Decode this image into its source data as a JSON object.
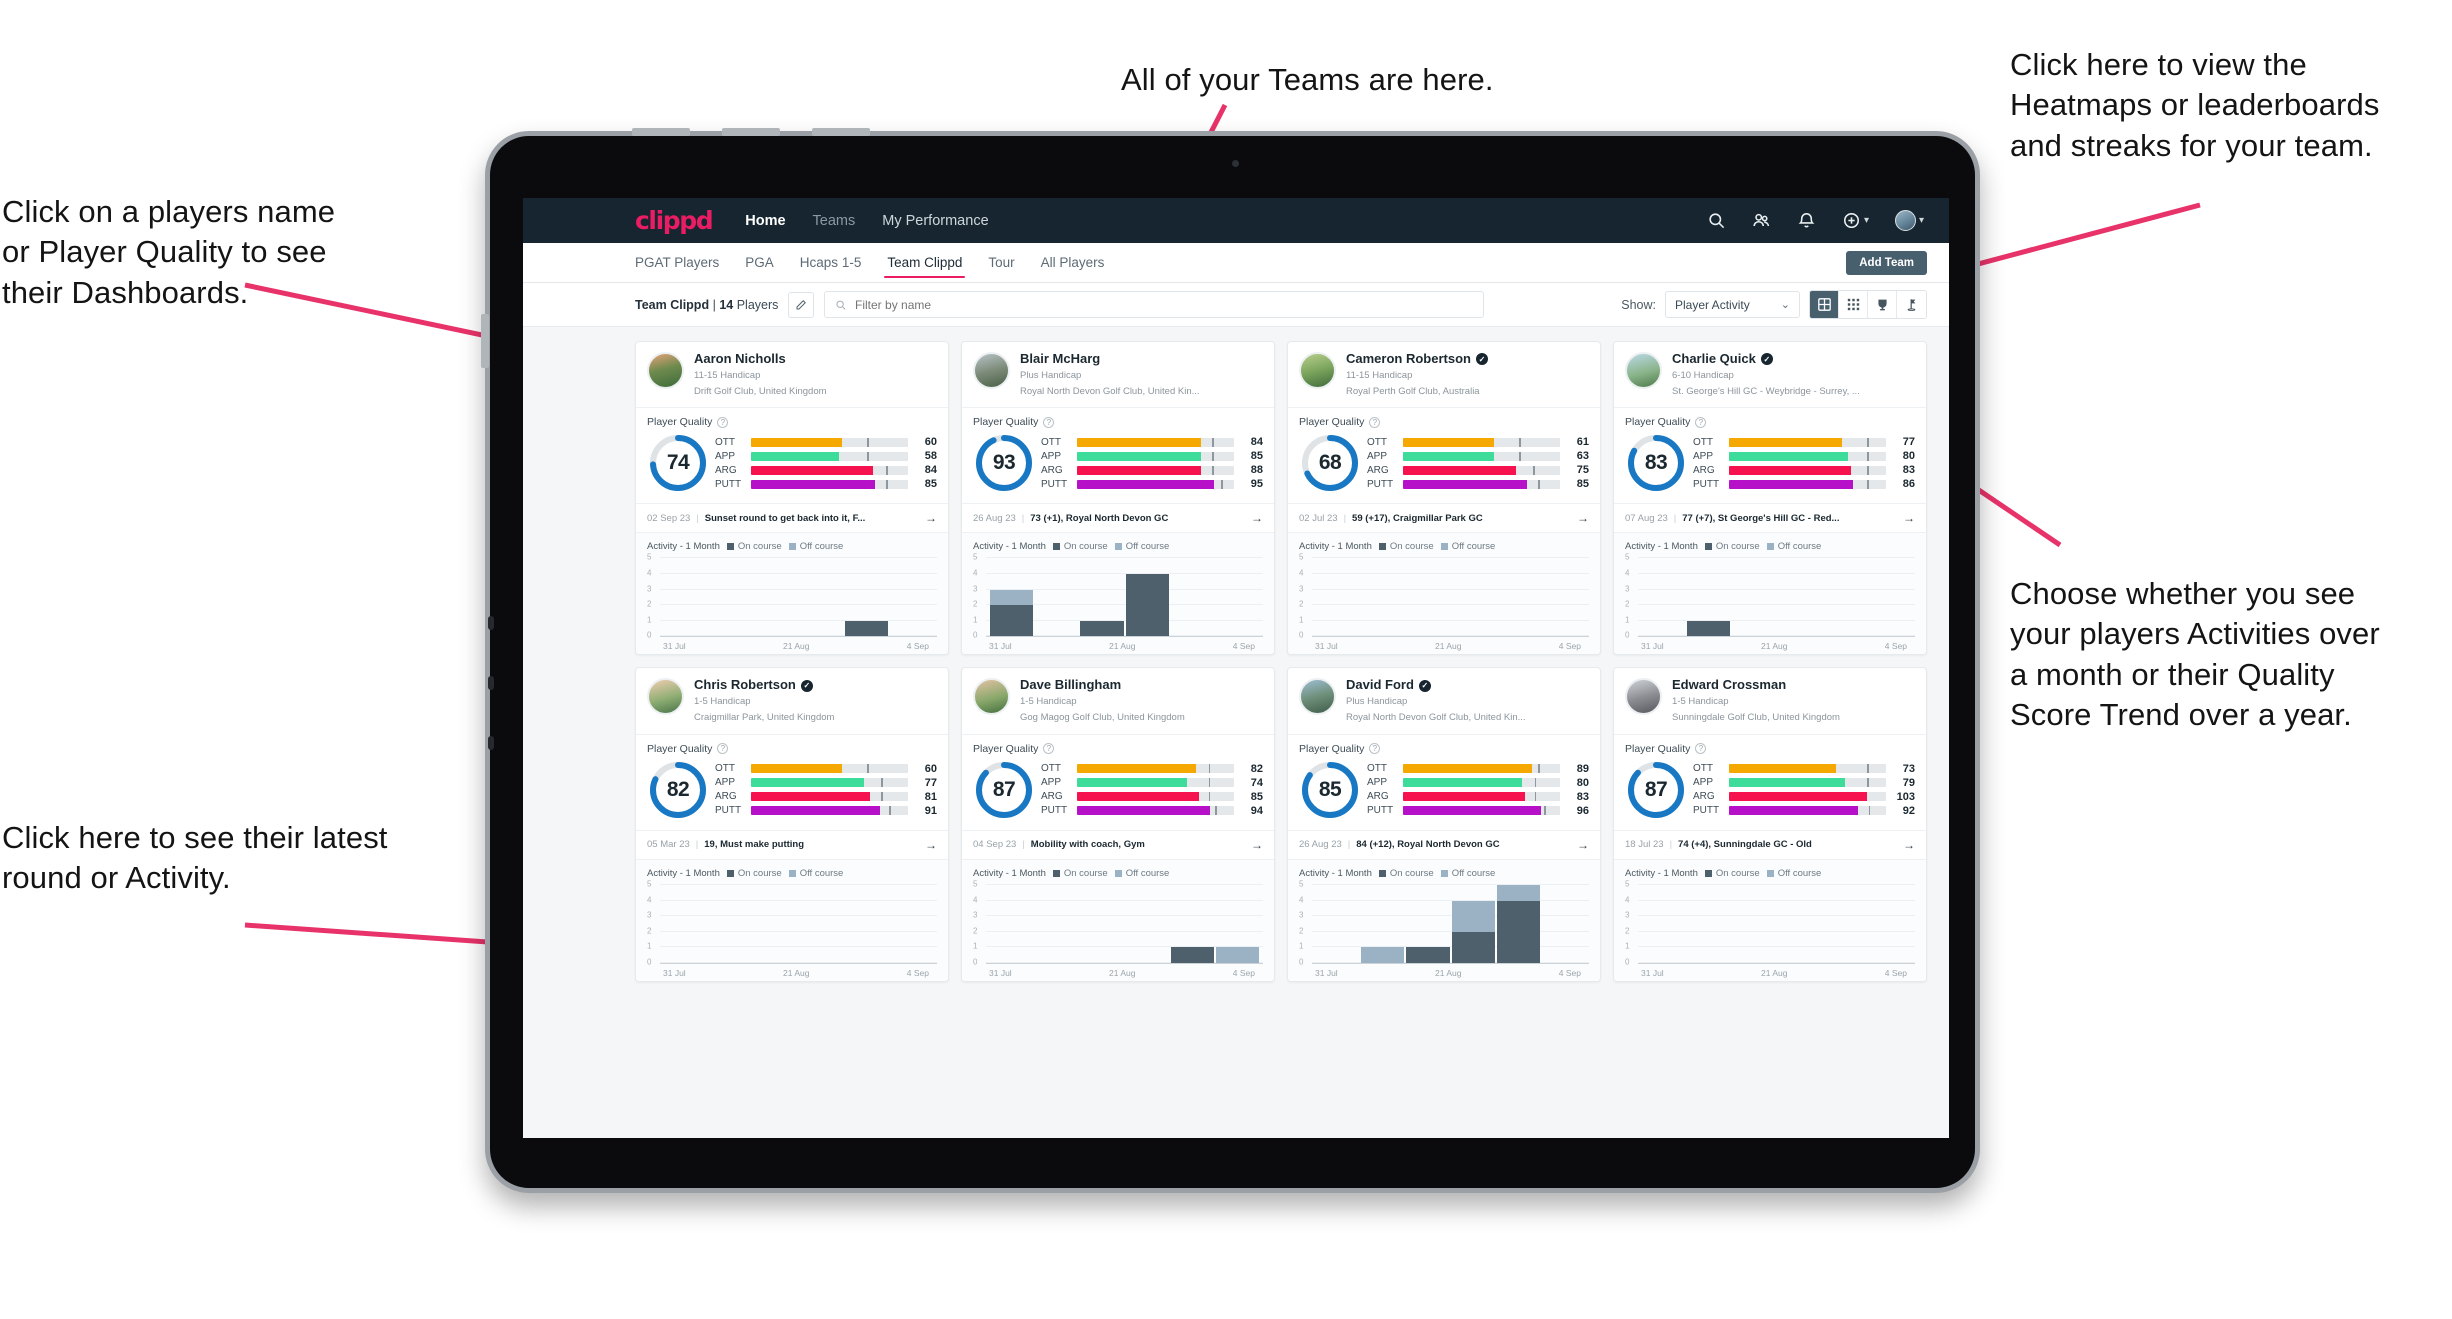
{
  "annotations": {
    "top": "All of your Teams are here.",
    "left_top": "Click on a players name\nor Player Quality to see\ntheir Dashboards.",
    "left_bottom": "Click here to see their latest\nround or Activity.",
    "right_top": "Click here to view the\nHeatmaps or leaderboards\nand streaks for your team.",
    "right_bottom": "Choose whether you see\nyour players Activities over\na month or their Quality\nScore Trend over a year.",
    "arrow_color": "#e8336a"
  },
  "app": {
    "brand": "clippd",
    "nav": [
      {
        "label": "Home",
        "active": true
      },
      {
        "label": "Teams",
        "active": false
      },
      {
        "label": "My Performance",
        "active": false
      }
    ],
    "nav_icons": [
      "search-icon",
      "people-icon",
      "bell-icon",
      "plus-circle-icon",
      "avatar"
    ],
    "tabs": [
      {
        "label": "PGAT Players",
        "active": false
      },
      {
        "label": "PGA",
        "active": false
      },
      {
        "label": "Hcaps 1-5",
        "active": false
      },
      {
        "label": "Team Clippd",
        "active": true
      },
      {
        "label": "Tour",
        "active": false
      },
      {
        "label": "All Players",
        "active": false
      }
    ],
    "add_team_label": "Add Team",
    "toolbar": {
      "team_name": "Team Clippd",
      "separator": "|",
      "player_count": "14",
      "players_word": "Players",
      "edit_icon": "pencil-icon",
      "search_placeholder": "Filter by name",
      "search_value": "",
      "show_label": "Show:",
      "show_value": "Player Activity",
      "view_buttons": [
        "grid-large-icon",
        "grid-small-icon",
        "trophy-icon",
        "flag-icon"
      ],
      "active_view": 0
    },
    "quality_label": "Player Quality",
    "activity_label": "Activity - 1 Month",
    "legend_on": "On course",
    "legend_off": "Off course",
    "x_ticks": [
      "31 Jul",
      "21 Aug",
      "4 Sep"
    ],
    "y_ticks": [
      "5",
      "4",
      "3",
      "2",
      "1",
      "0"
    ],
    "metric_colors": {
      "OTT": "#f5a800",
      "APP": "#3ddc9b",
      "ARG": "#f5124f",
      "PUTT": "#b610c9",
      "ring": "#1878c4",
      "ring_track": "#dfe3e6"
    }
  },
  "chart_data": {
    "type": "bar",
    "title": "Activity - 1 Month",
    "xlabel": "",
    "ylabel": "",
    "ylim": [
      0,
      5
    ],
    "categories": [
      "31 Jul",
      "7 Aug",
      "14 Aug",
      "21 Aug",
      "28 Aug",
      "4 Sep"
    ],
    "legend": [
      "On course",
      "Off course"
    ],
    "legend_position": "top",
    "grid": true,
    "per_player": [
      {
        "player": "Aaron Nicholls",
        "on": [
          0,
          0,
          0,
          0,
          1,
          0
        ],
        "off": [
          0,
          0,
          0,
          0,
          0,
          0
        ]
      },
      {
        "player": "Blair McHarg",
        "on": [
          2,
          0,
          1,
          4,
          0,
          0
        ],
        "off": [
          1,
          0,
          0,
          0,
          0,
          0
        ]
      },
      {
        "player": "Cameron Robertson",
        "on": [
          0,
          0,
          0,
          0,
          0,
          0
        ],
        "off": [
          0,
          0,
          0,
          0,
          0,
          0
        ]
      },
      {
        "player": "Charlie Quick",
        "on": [
          0,
          1,
          0,
          0,
          0,
          0
        ],
        "off": [
          0,
          0,
          0,
          0,
          0,
          0
        ]
      },
      {
        "player": "Chris Robertson",
        "on": [
          0,
          0,
          0,
          0,
          0,
          0
        ],
        "off": [
          0,
          0,
          0,
          0,
          0,
          0
        ]
      },
      {
        "player": "Dave Billingham",
        "on": [
          0,
          0,
          0,
          0,
          1,
          0
        ],
        "off": [
          0,
          0,
          0,
          0,
          0,
          1
        ]
      },
      {
        "player": "David Ford",
        "on": [
          0,
          0,
          1,
          2,
          4,
          0
        ],
        "off": [
          0,
          1,
          0,
          2,
          1,
          0
        ]
      },
      {
        "player": "Edward Crossman",
        "on": [
          0,
          0,
          0,
          0,
          0,
          0
        ],
        "off": [
          0,
          0,
          0,
          0,
          0,
          0
        ]
      }
    ]
  },
  "players": [
    {
      "name": "Aaron Nicholls",
      "verified": false,
      "handicap": "11-15 Handicap",
      "club": "Drift Golf Club, United Kingdom",
      "quality": "74",
      "metrics": [
        {
          "label": "OTT",
          "value": "60",
          "fill": 58,
          "tick": 74
        },
        {
          "label": "APP",
          "value": "58",
          "fill": 56,
          "tick": 74
        },
        {
          "label": "ARG",
          "value": "84",
          "fill": 78,
          "tick": 86
        },
        {
          "label": "PUTT",
          "value": "85",
          "fill": 79,
          "tick": 86
        }
      ],
      "round_date": "02 Sep 23",
      "round_title": "Sunset round to get back into it, F..."
    },
    {
      "name": "Blair McHarg",
      "verified": false,
      "handicap": "Plus Handicap",
      "club": "Royal North Devon Golf Club, United Kin...",
      "quality": "93",
      "metrics": [
        {
          "label": "OTT",
          "value": "84",
          "fill": 79,
          "tick": 86
        },
        {
          "label": "APP",
          "value": "85",
          "fill": 79,
          "tick": 86
        },
        {
          "label": "ARG",
          "value": "88",
          "fill": 79,
          "tick": 86
        },
        {
          "label": "PUTT",
          "value": "95",
          "fill": 87,
          "tick": 92
        }
      ],
      "round_date": "26 Aug 23",
      "round_title": "73 (+1), Royal North Devon GC"
    },
    {
      "name": "Cameron Robertson",
      "verified": true,
      "handicap": "11-15 Handicap",
      "club": "Royal Perth Golf Club, Australia",
      "quality": "68",
      "metrics": [
        {
          "label": "OTT",
          "value": "61",
          "fill": 58,
          "tick": 74
        },
        {
          "label": "APP",
          "value": "63",
          "fill": 58,
          "tick": 74
        },
        {
          "label": "ARG",
          "value": "75",
          "fill": 72,
          "tick": 83
        },
        {
          "label": "PUTT",
          "value": "85",
          "fill": 79,
          "tick": 86
        }
      ],
      "round_date": "02 Jul 23",
      "round_title": "59 (+17), Craigmillar Park GC"
    },
    {
      "name": "Charlie Quick",
      "verified": true,
      "handicap": "6-10 Handicap",
      "club": "St. George's Hill GC - Weybridge - Surrey, ...",
      "quality": "83",
      "metrics": [
        {
          "label": "OTT",
          "value": "77",
          "fill": 72,
          "tick": 88
        },
        {
          "label": "APP",
          "value": "80",
          "fill": 76,
          "tick": 88
        },
        {
          "label": "ARG",
          "value": "83",
          "fill": 78,
          "tick": 88
        },
        {
          "label": "PUTT",
          "value": "86",
          "fill": 79,
          "tick": 88
        }
      ],
      "round_date": "07 Aug 23",
      "round_title": "77 (+7), St George's Hill GC - Red..."
    },
    {
      "name": "Chris Robertson",
      "verified": true,
      "handicap": "1-5 Handicap",
      "club": "Craigmillar Park, United Kingdom",
      "quality": "82",
      "metrics": [
        {
          "label": "OTT",
          "value": "60",
          "fill": 58,
          "tick": 74
        },
        {
          "label": "APP",
          "value": "77",
          "fill": 72,
          "tick": 83
        },
        {
          "label": "ARG",
          "value": "81",
          "fill": 76,
          "tick": 83
        },
        {
          "label": "PUTT",
          "value": "91",
          "fill": 82,
          "tick": 88
        }
      ],
      "round_date": "05 Mar 23",
      "round_title": "19, Must make putting"
    },
    {
      "name": "Dave Billingham",
      "verified": false,
      "handicap": "1-5 Handicap",
      "club": "Gog Magog Golf Club, United Kingdom",
      "quality": "87",
      "metrics": [
        {
          "label": "OTT",
          "value": "82",
          "fill": 76,
          "tick": 84
        },
        {
          "label": "APP",
          "value": "74",
          "fill": 70,
          "tick": 84
        },
        {
          "label": "ARG",
          "value": "85",
          "fill": 78,
          "tick": 84
        },
        {
          "label": "PUTT",
          "value": "94",
          "fill": 85,
          "tick": 88
        }
      ],
      "round_date": "04 Sep 23",
      "round_title": "Mobility with coach, Gym"
    },
    {
      "name": "David Ford",
      "verified": true,
      "handicap": "Plus Handicap",
      "club": "Royal North Devon Golf Club, United Kin...",
      "quality": "85",
      "metrics": [
        {
          "label": "OTT",
          "value": "89",
          "fill": 82,
          "tick": 86
        },
        {
          "label": "APP",
          "value": "80",
          "fill": 76,
          "tick": 84
        },
        {
          "label": "ARG",
          "value": "83",
          "fill": 78,
          "tick": 84
        },
        {
          "label": "PUTT",
          "value": "96",
          "fill": 88,
          "tick": 90
        }
      ],
      "round_date": "26 Aug 23",
      "round_title": "84 (+12), Royal North Devon GC"
    },
    {
      "name": "Edward Crossman",
      "verified": false,
      "handicap": "1-5 Handicap",
      "club": "Sunningdale Golf Club, United Kingdom",
      "quality": "87",
      "metrics": [
        {
          "label": "OTT",
          "value": "73",
          "fill": 68,
          "tick": 88
        },
        {
          "label": "APP",
          "value": "79",
          "fill": 74,
          "tick": 88
        },
        {
          "label": "ARG",
          "value": "103",
          "fill": 88,
          "tick": 0
        },
        {
          "label": "PUTT",
          "value": "92",
          "fill": 82,
          "tick": 89
        }
      ],
      "round_date": "18 Jul 23",
      "round_title": "74 (+4), Sunningdale GC - Old"
    }
  ]
}
